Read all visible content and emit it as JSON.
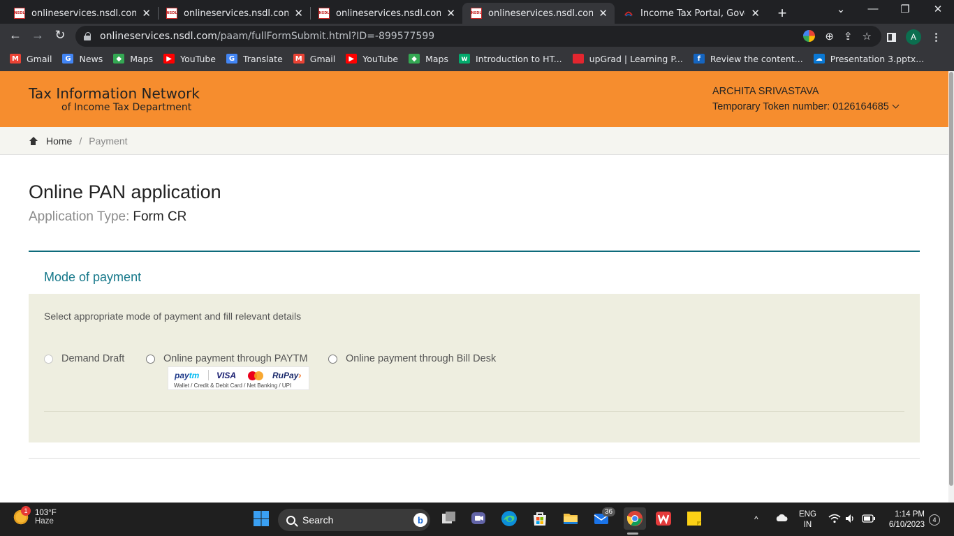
{
  "browser": {
    "tabs": [
      {
        "title": "onlineservices.nsdl.com/paam/fullFormSubmit.html",
        "favicon": "nsdl-icon",
        "close": "✕"
      },
      {
        "title": "onlineservices.nsdl.com/paam/fullFormSubmit.html",
        "favicon": "nsdl-icon",
        "close": "✕"
      },
      {
        "title": "onlineservices.nsdl.com/paam/fullFormSubmit.html",
        "favicon": "nsdl-icon",
        "close": "✕"
      },
      {
        "title": "onlineservices.nsdl.com/paam/fullFormSubmit.html",
        "favicon": "nsdl-icon",
        "close": "✕"
      },
      {
        "title": "Income Tax Portal, Government of India",
        "favicon": "income-tax-icon",
        "close": "✕"
      }
    ],
    "new_tab": "+",
    "window_controls": {
      "tabsearch": "⌄",
      "minimize": "—",
      "restore": "❐",
      "close": "✕"
    },
    "nav": {
      "back": "←",
      "forward": "→",
      "reload": "↻"
    },
    "url_domain": "onlineservices.nsdl.com",
    "url_path": "/paam/fullFormSubmit.html?ID=-899577599",
    "omnibox_icons": {
      "zoom": "⊕",
      "share": "⇪",
      "bookmark": "☆"
    },
    "profile_initial": "A",
    "bookmarks": [
      {
        "label": "Gmail",
        "icon": "gmail-icon",
        "icon_text": "M",
        "color": "#ea4335"
      },
      {
        "label": "News",
        "icon": "news-icon",
        "icon_text": "G",
        "color": "#4285f4"
      },
      {
        "label": "Maps",
        "icon": "maps-icon",
        "icon_text": "◆",
        "color": "#34a853"
      },
      {
        "label": "YouTube",
        "icon": "youtube-icon",
        "icon_text": "▶",
        "color": "#ff0000"
      },
      {
        "label": "Translate",
        "icon": "translate-icon",
        "icon_text": "G",
        "color": "#4285f4"
      },
      {
        "label": "Gmail",
        "icon": "gmail-icon",
        "icon_text": "M",
        "color": "#ea4335"
      },
      {
        "label": "YouTube",
        "icon": "youtube-icon",
        "icon_text": "▶",
        "color": "#ff0000"
      },
      {
        "label": "Maps",
        "icon": "maps-icon",
        "icon_text": "◆",
        "color": "#34a853"
      },
      {
        "label": "Introduction to HT...",
        "icon": "w3schools-icon",
        "icon_text": "w",
        "color": "#04aa6d"
      },
      {
        "label": "upGrad | Learning P...",
        "icon": "upgrad-icon",
        "icon_text": "",
        "color": "#e3262f"
      },
      {
        "label": "Review the content...",
        "icon": "doc-icon",
        "icon_text": "f",
        "color": "#1565c0"
      },
      {
        "label": "Presentation 3.pptx...",
        "icon": "onedrive-icon",
        "icon_text": "☁",
        "color": "#0a78d4"
      }
    ]
  },
  "header": {
    "logo_line1": "Tax Information Network",
    "logo_line2": "of Income Tax Department",
    "user_name": "ARCHITA SRIVASTAVA",
    "token_text": "Temporary Token number: 0126164685"
  },
  "breadcrumb": {
    "home": "Home",
    "separator": "/",
    "current": "Payment"
  },
  "main": {
    "title": "Online PAN application",
    "app_type_label": "Application Type:",
    "app_type_value": "Form CR"
  },
  "payment": {
    "section_title": "Mode of payment",
    "instruction": "Select appropriate mode of payment and fill relevant details",
    "options": [
      {
        "label": "Demand Draft"
      },
      {
        "label": "Online payment through PAYTM"
      },
      {
        "label": "Online payment through Bill Desk"
      }
    ],
    "paytm_logo": {
      "paytm_a": "pay",
      "paytm_b": "tm",
      "visa": "VISA",
      "rupay_a": "RuPay",
      "rupay_b": "›",
      "subtitle": "Wallet / Credit & Debit Card / Net Banking / UPI"
    }
  },
  "taskbar": {
    "weather_temp": "103°F",
    "weather_desc": "Haze",
    "weather_badge": "1",
    "search_label": "Search",
    "search_badge": "b",
    "app_badge": "36",
    "lang1": "ENG",
    "lang2": "IN",
    "time": "1:14 PM",
    "date": "6/10/2023",
    "notifications": "4",
    "tray_chevron": "^"
  }
}
